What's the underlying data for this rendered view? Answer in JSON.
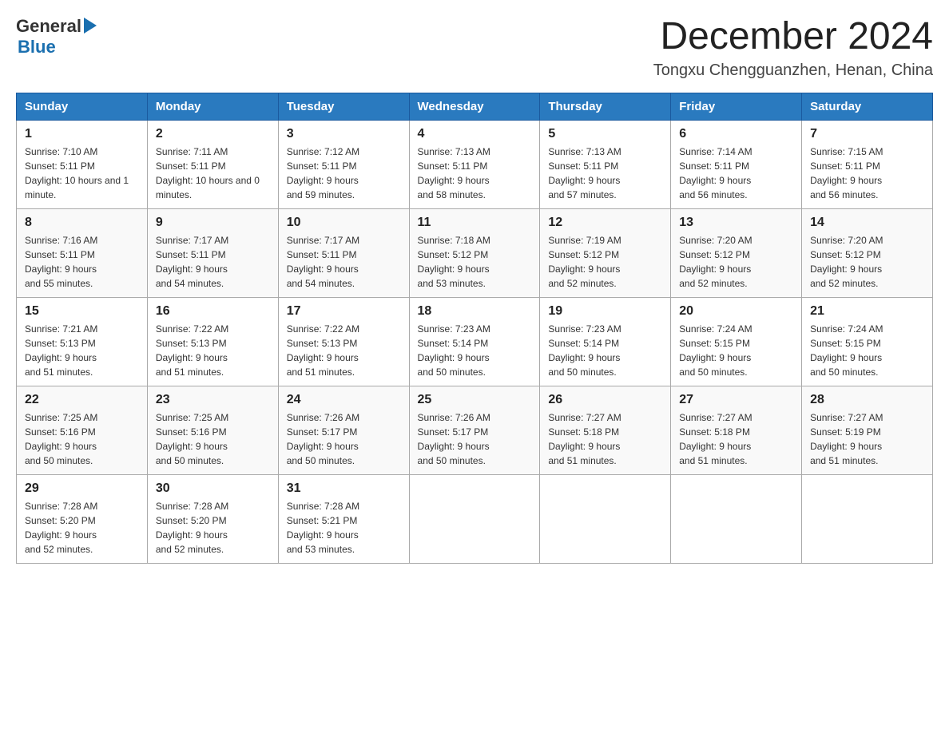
{
  "logo": {
    "general": "General",
    "blue": "Blue"
  },
  "title": "December 2024",
  "subtitle": "Tongxu Chengguanzhen, Henan, China",
  "days_header": [
    "Sunday",
    "Monday",
    "Tuesday",
    "Wednesday",
    "Thursday",
    "Friday",
    "Saturday"
  ],
  "weeks": [
    [
      {
        "day": "1",
        "sunrise": "7:10 AM",
        "sunset": "5:11 PM",
        "daylight": "10 hours and 1 minute."
      },
      {
        "day": "2",
        "sunrise": "7:11 AM",
        "sunset": "5:11 PM",
        "daylight": "10 hours and 0 minutes."
      },
      {
        "day": "3",
        "sunrise": "7:12 AM",
        "sunset": "5:11 PM",
        "daylight": "9 hours and 59 minutes."
      },
      {
        "day": "4",
        "sunrise": "7:13 AM",
        "sunset": "5:11 PM",
        "daylight": "9 hours and 58 minutes."
      },
      {
        "day": "5",
        "sunrise": "7:13 AM",
        "sunset": "5:11 PM",
        "daylight": "9 hours and 57 minutes."
      },
      {
        "day": "6",
        "sunrise": "7:14 AM",
        "sunset": "5:11 PM",
        "daylight": "9 hours and 56 minutes."
      },
      {
        "day": "7",
        "sunrise": "7:15 AM",
        "sunset": "5:11 PM",
        "daylight": "9 hours and 56 minutes."
      }
    ],
    [
      {
        "day": "8",
        "sunrise": "7:16 AM",
        "sunset": "5:11 PM",
        "daylight": "9 hours and 55 minutes."
      },
      {
        "day": "9",
        "sunrise": "7:17 AM",
        "sunset": "5:11 PM",
        "daylight": "9 hours and 54 minutes."
      },
      {
        "day": "10",
        "sunrise": "7:17 AM",
        "sunset": "5:11 PM",
        "daylight": "9 hours and 54 minutes."
      },
      {
        "day": "11",
        "sunrise": "7:18 AM",
        "sunset": "5:12 PM",
        "daylight": "9 hours and 53 minutes."
      },
      {
        "day": "12",
        "sunrise": "7:19 AM",
        "sunset": "5:12 PM",
        "daylight": "9 hours and 52 minutes."
      },
      {
        "day": "13",
        "sunrise": "7:20 AM",
        "sunset": "5:12 PM",
        "daylight": "9 hours and 52 minutes."
      },
      {
        "day": "14",
        "sunrise": "7:20 AM",
        "sunset": "5:12 PM",
        "daylight": "9 hours and 52 minutes."
      }
    ],
    [
      {
        "day": "15",
        "sunrise": "7:21 AM",
        "sunset": "5:13 PM",
        "daylight": "9 hours and 51 minutes."
      },
      {
        "day": "16",
        "sunrise": "7:22 AM",
        "sunset": "5:13 PM",
        "daylight": "9 hours and 51 minutes."
      },
      {
        "day": "17",
        "sunrise": "7:22 AM",
        "sunset": "5:13 PM",
        "daylight": "9 hours and 51 minutes."
      },
      {
        "day": "18",
        "sunrise": "7:23 AM",
        "sunset": "5:14 PM",
        "daylight": "9 hours and 50 minutes."
      },
      {
        "day": "19",
        "sunrise": "7:23 AM",
        "sunset": "5:14 PM",
        "daylight": "9 hours and 50 minutes."
      },
      {
        "day": "20",
        "sunrise": "7:24 AM",
        "sunset": "5:15 PM",
        "daylight": "9 hours and 50 minutes."
      },
      {
        "day": "21",
        "sunrise": "7:24 AM",
        "sunset": "5:15 PM",
        "daylight": "9 hours and 50 minutes."
      }
    ],
    [
      {
        "day": "22",
        "sunrise": "7:25 AM",
        "sunset": "5:16 PM",
        "daylight": "9 hours and 50 minutes."
      },
      {
        "day": "23",
        "sunrise": "7:25 AM",
        "sunset": "5:16 PM",
        "daylight": "9 hours and 50 minutes."
      },
      {
        "day": "24",
        "sunrise": "7:26 AM",
        "sunset": "5:17 PM",
        "daylight": "9 hours and 50 minutes."
      },
      {
        "day": "25",
        "sunrise": "7:26 AM",
        "sunset": "5:17 PM",
        "daylight": "9 hours and 50 minutes."
      },
      {
        "day": "26",
        "sunrise": "7:27 AM",
        "sunset": "5:18 PM",
        "daylight": "9 hours and 51 minutes."
      },
      {
        "day": "27",
        "sunrise": "7:27 AM",
        "sunset": "5:18 PM",
        "daylight": "9 hours and 51 minutes."
      },
      {
        "day": "28",
        "sunrise": "7:27 AM",
        "sunset": "5:19 PM",
        "daylight": "9 hours and 51 minutes."
      }
    ],
    [
      {
        "day": "29",
        "sunrise": "7:28 AM",
        "sunset": "5:20 PM",
        "daylight": "9 hours and 52 minutes."
      },
      {
        "day": "30",
        "sunrise": "7:28 AM",
        "sunset": "5:20 PM",
        "daylight": "9 hours and 52 minutes."
      },
      {
        "day": "31",
        "sunrise": "7:28 AM",
        "sunset": "5:21 PM",
        "daylight": "9 hours and 53 minutes."
      },
      null,
      null,
      null,
      null
    ]
  ],
  "labels": {
    "sunrise_prefix": "Sunrise: ",
    "sunset_prefix": "Sunset: ",
    "daylight_prefix": "Daylight: "
  }
}
